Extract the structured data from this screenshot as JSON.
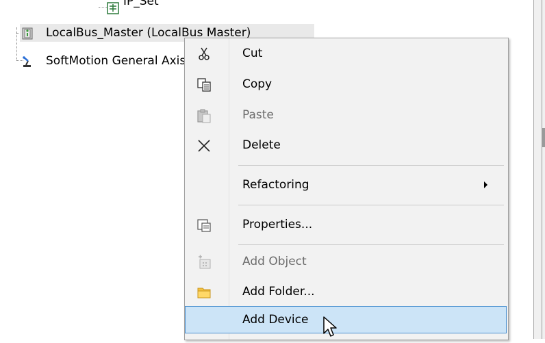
{
  "tree": {
    "items": [
      {
        "label": "IP_Set",
        "icon": "tag-list-icon"
      },
      {
        "label": "LocalBus_Master (LocalBus Master)",
        "icon": "module-icon"
      },
      {
        "label": "SoftMotion General Axis Pool",
        "icon": "axis-arm-icon"
      }
    ]
  },
  "context_menu": {
    "items": [
      {
        "label": "Cut",
        "icon": "scissors-icon",
        "enabled": true
      },
      {
        "label": "Copy",
        "icon": "copy-icon",
        "enabled": true
      },
      {
        "label": "Paste",
        "icon": "paste-icon",
        "enabled": false
      },
      {
        "label": "Delete",
        "icon": "delete-x-icon",
        "enabled": true
      },
      {
        "label": "Refactoring",
        "submenu": true,
        "enabled": true
      },
      {
        "label": "Properties...",
        "icon": "properties-icon",
        "enabled": true
      },
      {
        "label": "Add Object",
        "icon": "add-object-icon",
        "enabled": false
      },
      {
        "label": "Add Folder...",
        "icon": "folder-icon",
        "enabled": true
      },
      {
        "label": "Add Device",
        "highlighted": true,
        "enabled": true
      }
    ]
  },
  "colors": {
    "highlight_bg": "#cce4f7",
    "highlight_border": "#4a90d0",
    "menu_bg": "#f2f2f2",
    "disabled_text": "#6d6d6d",
    "selected_row_bg": "#e9e9e9"
  }
}
